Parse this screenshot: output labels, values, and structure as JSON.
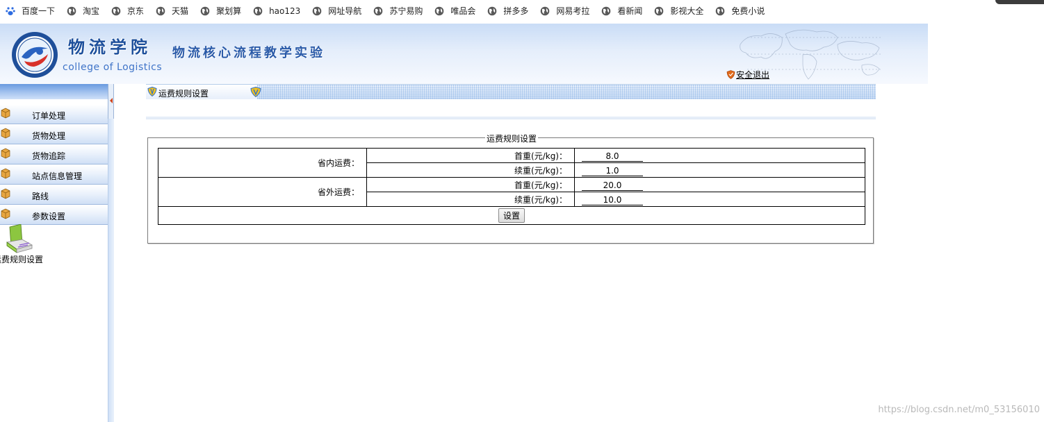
{
  "bookmarks": [
    {
      "label": "百度一下",
      "icon": "baidu-paw-icon"
    },
    {
      "label": "淘宝",
      "icon": "globe-icon"
    },
    {
      "label": "京东",
      "icon": "globe-icon"
    },
    {
      "label": "天猫",
      "icon": "globe-icon"
    },
    {
      "label": "聚划算",
      "icon": "globe-icon"
    },
    {
      "label": "hao123",
      "icon": "globe-icon"
    },
    {
      "label": "网址导航",
      "icon": "globe-icon"
    },
    {
      "label": "苏宁易购",
      "icon": "globe-icon"
    },
    {
      "label": "唯品会",
      "icon": "globe-icon"
    },
    {
      "label": "拼多多",
      "icon": "globe-icon"
    },
    {
      "label": "网易考拉",
      "icon": "globe-icon"
    },
    {
      "label": "看新闻",
      "icon": "globe-icon"
    },
    {
      "label": "影视大全",
      "icon": "globe-icon"
    },
    {
      "label": "免费小说",
      "icon": "globe-icon"
    }
  ],
  "header": {
    "school_cn": "物流学院",
    "school_en": "college of Logistics",
    "system_title": "物流核心流程教学实验",
    "logout_label": "安全退出"
  },
  "sidebar": {
    "items": [
      {
        "label": "订单处理"
      },
      {
        "label": "货物处理"
      },
      {
        "label": "货物追踪"
      },
      {
        "label": "站点信息管理"
      },
      {
        "label": "路线"
      },
      {
        "label": "参数设置"
      }
    ],
    "shortcut_label": "运费规则设置"
  },
  "tabs": [
    {
      "label": "运费规则设置"
    }
  ],
  "form": {
    "legend": "运费规则设置",
    "in_province": {
      "label": "省内运费：",
      "first_weight_label": "首重(元/kg)：",
      "first_weight_value": "8.0",
      "extra_weight_label": "续重(元/kg)：",
      "extra_weight_value": "1.0"
    },
    "out_province": {
      "label": "省外运费：",
      "first_weight_label": "首重(元/kg)：",
      "first_weight_value": "20.0",
      "extra_weight_label": "续重(元/kg)：",
      "extra_weight_value": "10.0"
    },
    "submit_label": "设置"
  },
  "watermark": "https://blog.csdn.net/m0_53156010",
  "colors": {
    "header_title": "#1d4f9b",
    "header_bg": "#c9dcf6",
    "menu_border": "#9eb8de"
  }
}
